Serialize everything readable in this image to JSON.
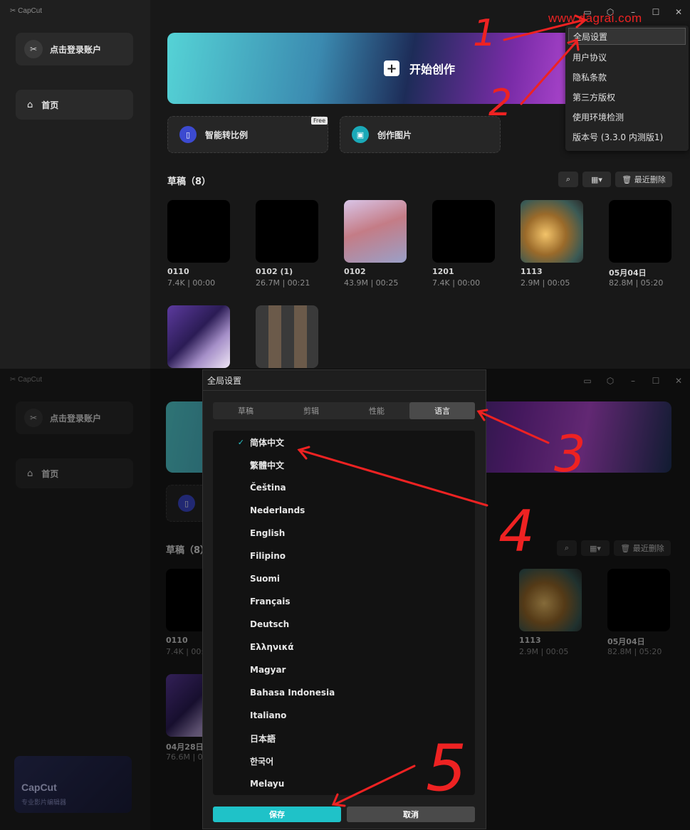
{
  "watermark": "www.dagrai.com",
  "app_name": "CapCut",
  "sidebar": {
    "login_label": "点击登录账户",
    "home_label": "首页"
  },
  "banner": {
    "cta_label": "开始创作"
  },
  "cards": [
    {
      "label": "智能转比例",
      "badge": "Free"
    },
    {
      "label": "创作图片"
    }
  ],
  "drafts": {
    "title": "草稿（8）",
    "recent_delete": "最近删除",
    "items": [
      {
        "name": "0110",
        "meta": "7.4K | 00:00"
      },
      {
        "name": "0102 (1)",
        "meta": "26.7M | 00:21"
      },
      {
        "name": "0102",
        "meta": "43.9M | 00:25"
      },
      {
        "name": "1201",
        "meta": "7.4K | 00:00"
      },
      {
        "name": "1113",
        "meta": "2.9M | 00:05"
      },
      {
        "name": "05月04日",
        "meta": "82.8M | 05:20"
      }
    ],
    "bottom_draft": {
      "name": "04月28日",
      "meta": "76.6M | 0"
    }
  },
  "menu": {
    "items": [
      "全局设置",
      "用户协议",
      "隐私条款",
      "第三方版权",
      "使用环境检测",
      "版本号 (3.3.0 内测版1)"
    ]
  },
  "dialog": {
    "title": "全局设置",
    "tabs": [
      "草稿",
      "剪辑",
      "性能",
      "语言"
    ],
    "selected_tab": 3,
    "languages": [
      "简体中文",
      "繁體中文",
      "Čeština",
      "Nederlands",
      "English",
      "Filipino",
      "Suomi",
      "Français",
      "Deutsch",
      "Ελληνικά",
      "Magyar",
      "Bahasa Indonesia",
      "Italiano",
      "日本語",
      "한국어",
      "Melayu"
    ],
    "selected_language": 0,
    "save_label": "保存",
    "cancel_label": "取消",
    "check": "✓"
  },
  "promo": {
    "title": "CapCut",
    "subtitle": "专业影片编辑器"
  },
  "annotations": [
    "1",
    "2",
    "3",
    "4",
    "5"
  ],
  "colors": {
    "accent": "#1fc2c8",
    "annotation": "#ee2222"
  }
}
